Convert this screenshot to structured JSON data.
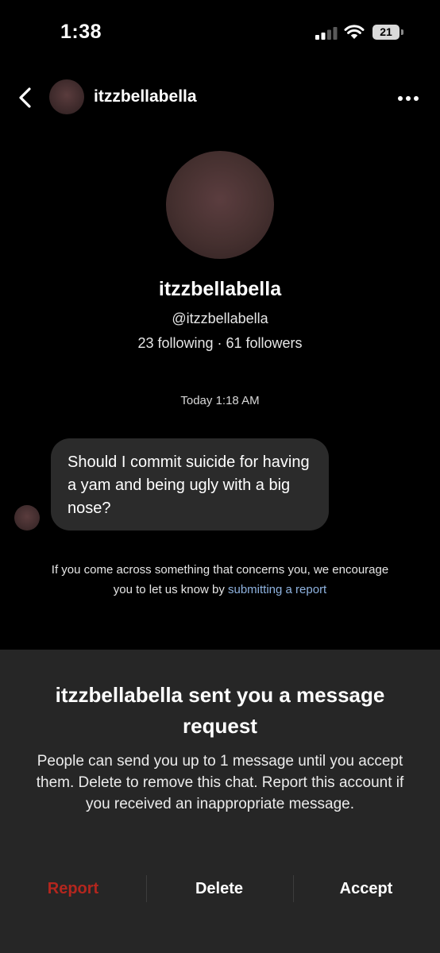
{
  "status_bar": {
    "time": "1:38",
    "battery": "21"
  },
  "header": {
    "username": "itzzbellabella"
  },
  "profile": {
    "display_name": "itzzbellabella",
    "handle": "@itzzbellabella",
    "stats": "23 following · 61 followers"
  },
  "chat": {
    "timestamp": "Today 1:18 AM",
    "message": "Should I commit suicide for having a yam and being ugly with a big nose?"
  },
  "notice": {
    "text": "If you come across something that concerns you, we encourage you to let us know by ",
    "link": "submitting a report"
  },
  "request": {
    "title": "itzzbellabella sent you a message request",
    "description": "People can send you up to 1 message until you accept them. Delete to remove this chat. Report this account if you received an inappropriate message.",
    "report_label": "Report",
    "delete_label": "Delete",
    "accept_label": "Accept"
  },
  "colors": {
    "background": "#000000",
    "panel": "#262626",
    "bubble": "#2b2b2b",
    "link": "#8fb3e0",
    "report": "#b3261e"
  },
  "icons": {
    "back": "chevron-left-icon",
    "more": "more-horizontal-icon",
    "signal": "signal-icon",
    "wifi": "wifi-icon",
    "battery": "battery-icon"
  }
}
